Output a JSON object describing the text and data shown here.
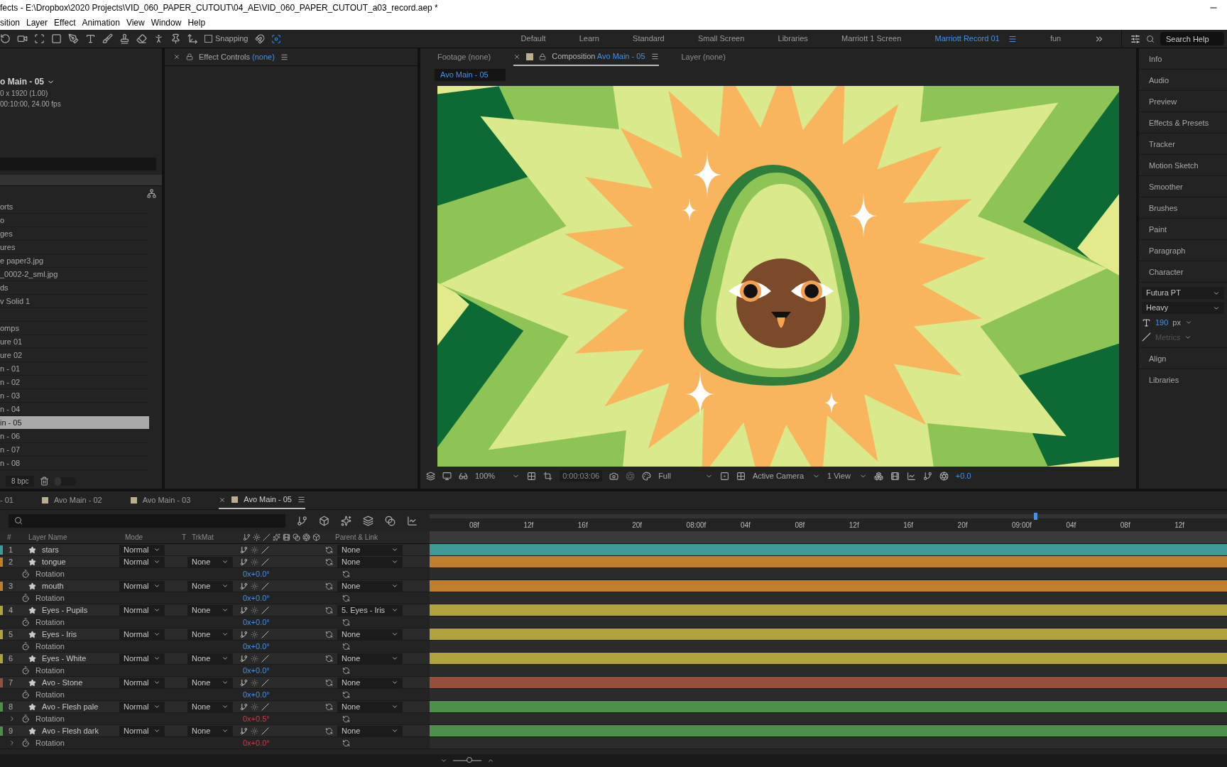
{
  "window": {
    "title": "fects - E:\\Dropbox\\2020 Projects\\VID_060_PAPER_CUTOUT\\04_AE\\VID_060_PAPER_CUTOUT_a03_record.aep *"
  },
  "menu": [
    "sition",
    "Layer",
    "Effect",
    "Animation",
    "View",
    "Window",
    "Help"
  ],
  "toolbar": {
    "snapping": {
      "label": "Snapping",
      "checked": false
    }
  },
  "workspaces": [
    {
      "label": "Default",
      "selected": false
    },
    {
      "label": "Learn",
      "selected": false
    },
    {
      "label": "Standard",
      "selected": false
    },
    {
      "label": "Small Screen",
      "selected": false
    },
    {
      "label": "Libraries",
      "selected": false
    },
    {
      "label": "Marriott 1 Screen",
      "selected": false
    },
    {
      "label": "Marriott Record 01",
      "selected": true
    },
    {
      "label": "fun",
      "selected": false
    }
  ],
  "search_help": {
    "placeholder": "Search Help"
  },
  "project": {
    "comp_name": "o Main - 05",
    "size": "0 x 1920 (1.00)",
    "duration": "00:10:00, 24.00 fps",
    "bpc": "8 bpc",
    "thumbnail_slider": {
      "level": 0.3
    },
    "items": [
      {
        "label": "orts",
        "selected": false
      },
      {
        "label": "o",
        "selected": false
      },
      {
        "label": "ges",
        "selected": false
      },
      {
        "label": "ures",
        "selected": false
      },
      {
        "label": "e paper3.jpg",
        "selected": false
      },
      {
        "label": "_0002-2_sml.jpg",
        "selected": false
      },
      {
        "label": "ds",
        "selected": false
      },
      {
        "label": "v Solid 1",
        "selected": false
      },
      {
        "label": "omps",
        "selected": false
      },
      {
        "label": "ure 01",
        "selected": false
      },
      {
        "label": "ure 02",
        "selected": false
      },
      {
        "label": "n - 01",
        "selected": false
      },
      {
        "label": "n - 02",
        "selected": false
      },
      {
        "label": "n - 03",
        "selected": false
      },
      {
        "label": "n - 04",
        "selected": false
      },
      {
        "label": "in - 05",
        "selected": true
      },
      {
        "label": "n - 06",
        "selected": false
      },
      {
        "label": "n - 07",
        "selected": false
      },
      {
        "label": "n - 08",
        "selected": false
      }
    ]
  },
  "effect_controls": {
    "title": "Effect Controls",
    "target": "(none)"
  },
  "viewer_tabs": [
    {
      "title": "Footage",
      "target": "(none)",
      "selected": false
    },
    {
      "title": "Composition",
      "target": "Avo Main - 05",
      "selected": true
    },
    {
      "title": "Layer",
      "target": "(none)",
      "selected": false
    }
  ],
  "viewer": {
    "breadcrumb": "Avo Main - 05",
    "zoom": "100%",
    "timecode": "0:00:03:06",
    "resolution": "Full",
    "camera": "Active Camera",
    "views": "1 View",
    "exposure": "+0.0"
  },
  "right_panels": {
    "top": [
      "Info",
      "Audio",
      "Preview",
      "Effects & Presets",
      "Tracker",
      "Motion Sketch",
      "Smoother",
      "Brushes",
      "Paint",
      "Paragraph",
      "Character"
    ],
    "character": {
      "font": "Futura PT",
      "style": "Heavy",
      "size": "190",
      "unit": "px",
      "kerning": "Metrics"
    },
    "bottom": [
      "Align",
      "Libraries"
    ]
  },
  "timeline": {
    "tabs": [
      {
        "label": "- 01",
        "selected": false
      },
      {
        "label": "Avo Main - 02",
        "selected": false
      },
      {
        "label": "Avo Main - 03",
        "selected": false
      },
      {
        "label": "Avo Main - 05",
        "selected": true
      }
    ],
    "zoom_slider": {
      "level": 0.6
    },
    "columns": [
      "#",
      "Layer Name",
      "Mode",
      "T",
      "TrkMat",
      "Parent & Link"
    ],
    "ruler": [
      "08f",
      "12f",
      "16f",
      "20f",
      "08:00f",
      "04f",
      "08f",
      "12f",
      "16f",
      "20f",
      "09:00f",
      "04f",
      "08f",
      "12f"
    ],
    "layers": [
      {
        "index": "1",
        "name": "stars",
        "color": "#3d9a98",
        "mode": "Normal",
        "parent": "None"
      },
      {
        "index": "2",
        "name": "tongue",
        "color": "#c07f2c",
        "mode": "Normal",
        "trkmat": "None",
        "parent": "None",
        "property": {
          "name": "Rotation",
          "value": "0x+0.0°",
          "expression": false,
          "twirl": false
        }
      },
      {
        "index": "3",
        "name": "mouth",
        "color": "#c07f2c",
        "mode": "Normal",
        "trkmat": "None",
        "parent": "None",
        "property": {
          "name": "Rotation",
          "value": "0x+0.0°",
          "expression": false,
          "twirl": false
        }
      },
      {
        "index": "4",
        "name": "Eyes - Pupils",
        "color": "#b0a23c",
        "mode": "Normal",
        "trkmat": "None",
        "parent": "5. Eyes - Iris",
        "property": {
          "name": "Rotation",
          "value": "0x+0.0°",
          "expression": false,
          "twirl": false
        }
      },
      {
        "index": "5",
        "name": "Eyes - Iris",
        "color": "#b0a23c",
        "mode": "Normal",
        "trkmat": "None",
        "parent": "None",
        "property": {
          "name": "Rotation",
          "value": "0x+0.0°",
          "expression": false,
          "twirl": false
        }
      },
      {
        "index": "6",
        "name": "Eyes - White",
        "color": "#b0a23c",
        "mode": "Normal",
        "trkmat": "None",
        "parent": "None",
        "property": {
          "name": "Rotation",
          "value": "0x+0.0°",
          "expression": false,
          "twirl": false
        }
      },
      {
        "index": "7",
        "name": "Avo - Stone",
        "color": "#94503c",
        "mode": "Normal",
        "trkmat": "None",
        "parent": "None",
        "property": {
          "name": "Rotation",
          "value": "0x+0.0°",
          "expression": false,
          "twirl": false
        }
      },
      {
        "index": "8",
        "name": "Avo - Flesh pale",
        "color": "#4f8f4c",
        "mode": "Normal",
        "trkmat": "None",
        "parent": "None",
        "property": {
          "name": "Rotation",
          "value": "0x+0.5°",
          "expression": true,
          "twirl": true
        }
      },
      {
        "index": "9",
        "name": "Avo - Flesh dark",
        "color": "#4f8f4c",
        "mode": "Normal",
        "trkmat": "None",
        "parent": "None",
        "property": {
          "name": "Rotation",
          "value": "0x+0.0°",
          "expression": true,
          "twirl": true
        }
      }
    ]
  }
}
